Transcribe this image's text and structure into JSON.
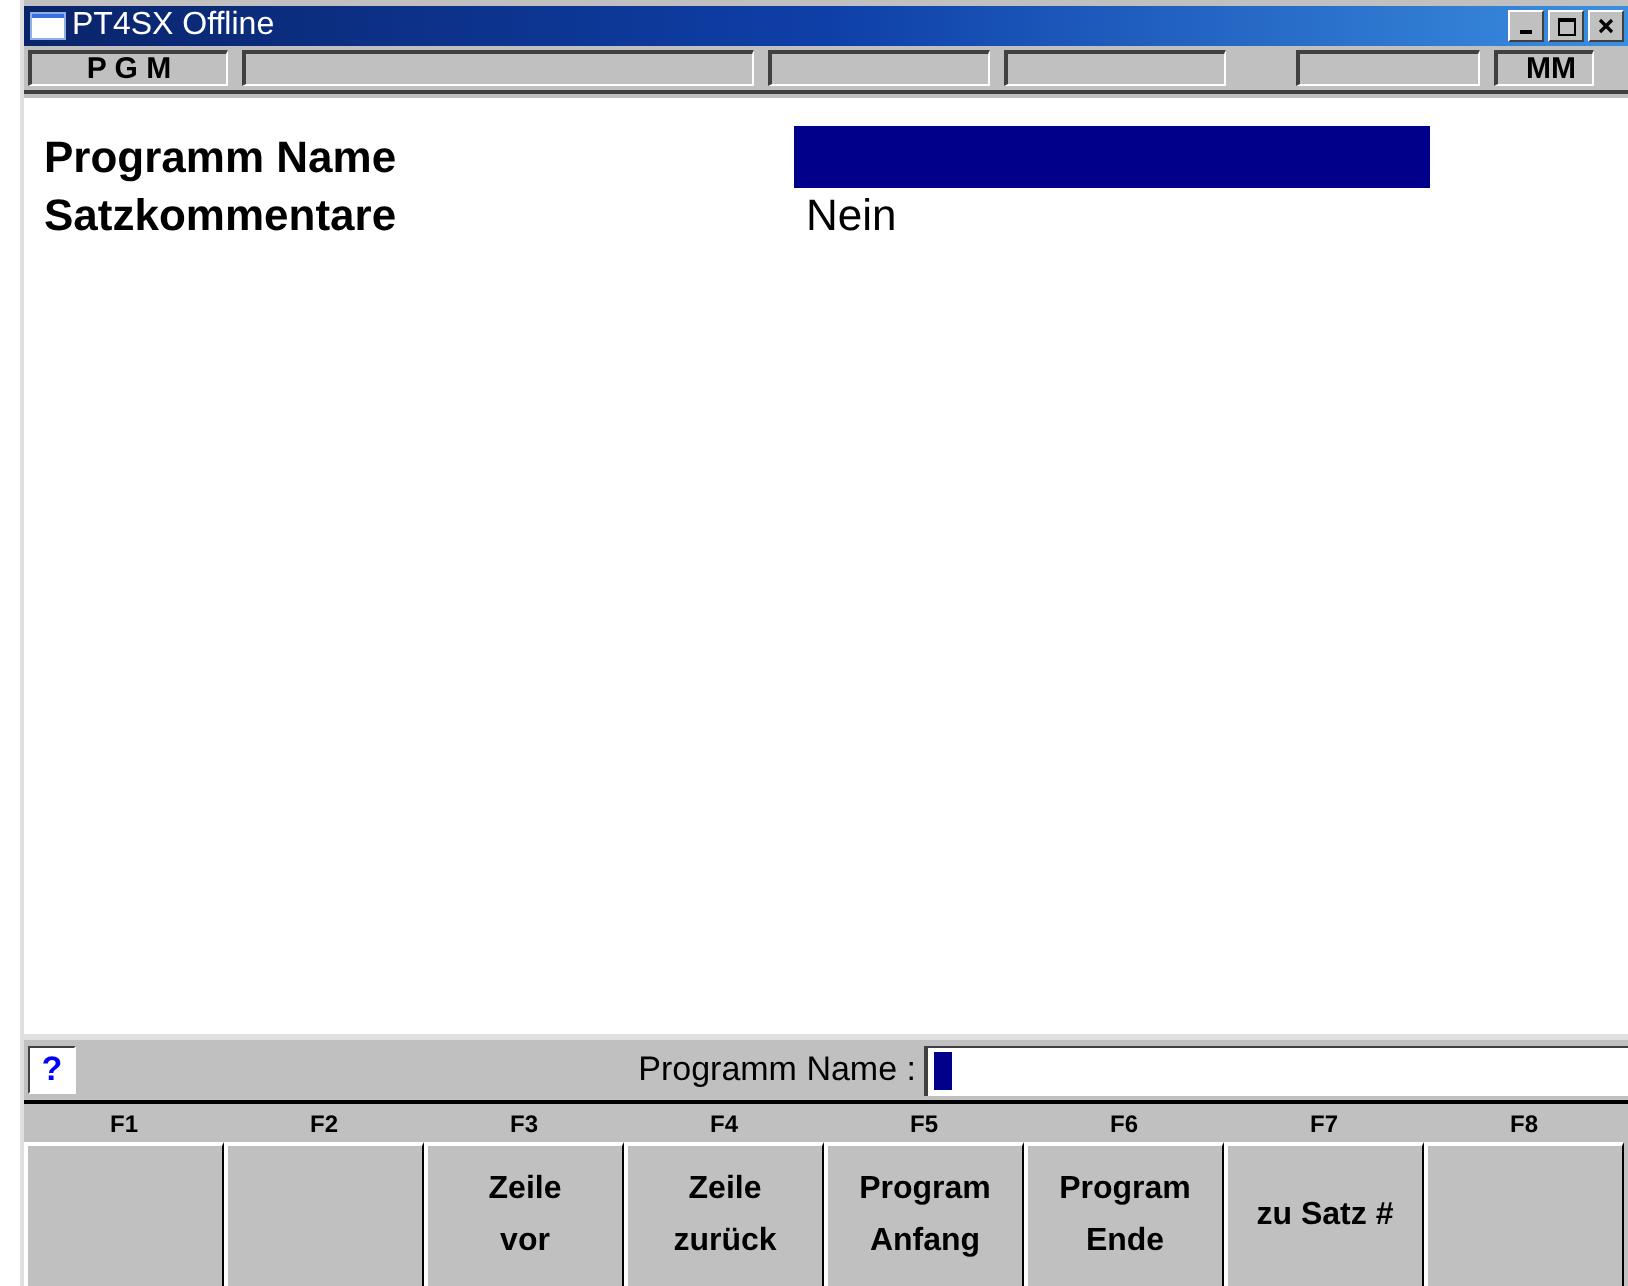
{
  "window": {
    "title": "PT4SX Offline"
  },
  "status_bar": {
    "mode": "P G M",
    "unit": "MM"
  },
  "fields": [
    {
      "label": "Programm Name",
      "kind": "highlight",
      "selected": true
    },
    {
      "label": "Satzkommentare",
      "value": "Nein",
      "kind": "text",
      "selected": false
    }
  ],
  "prompt": {
    "help": "?",
    "label": "Programm Name :"
  },
  "function_keys": [
    {
      "key": "F1"
    },
    {
      "key": "F2"
    },
    {
      "key": "F3",
      "label": "Zeile\nvor"
    },
    {
      "key": "F4",
      "label": "Zeile\nzurück"
    },
    {
      "key": "F5",
      "label": "Program\nAnfang"
    },
    {
      "key": "F6",
      "label": "Program\nEnde"
    },
    {
      "key": "F7",
      "label": "zu Satz #"
    },
    {
      "key": "F8"
    }
  ]
}
